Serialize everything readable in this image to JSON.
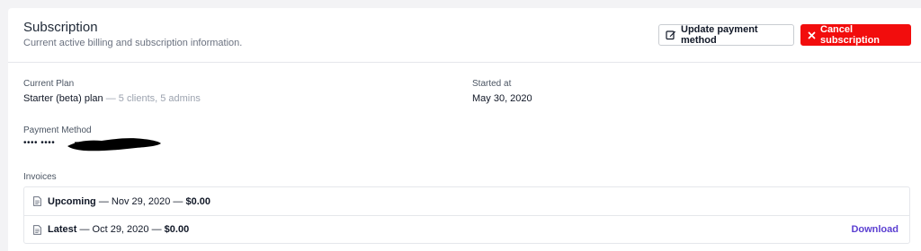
{
  "header": {
    "title": "Subscription",
    "subtitle": "Current active billing and subscription information."
  },
  "actions": {
    "update_label": "Update payment method",
    "cancel_label": "Cancel subscription"
  },
  "plan": {
    "label": "Current Plan",
    "name": "Starter (beta) plan",
    "details": " — 5 clients, 5 admins"
  },
  "started": {
    "label": "Started at",
    "date": "May 30, 2020"
  },
  "payment": {
    "label": "Payment Method",
    "masked": "•••• ••••"
  },
  "invoices": {
    "label": "Invoices",
    "items": [
      {
        "status": "Upcoming",
        "sep1": " — ",
        "date": "Nov 29, 2020",
        "sep2": " — ",
        "amount": "$0.00",
        "action": ""
      },
      {
        "status": "Latest",
        "sep1": " — ",
        "date": "Oct 29, 2020",
        "sep2": " — ",
        "amount": "$0.00",
        "action": "Download"
      }
    ]
  },
  "colors": {
    "danger": "#f20d0d",
    "link": "#5b3fd1"
  }
}
